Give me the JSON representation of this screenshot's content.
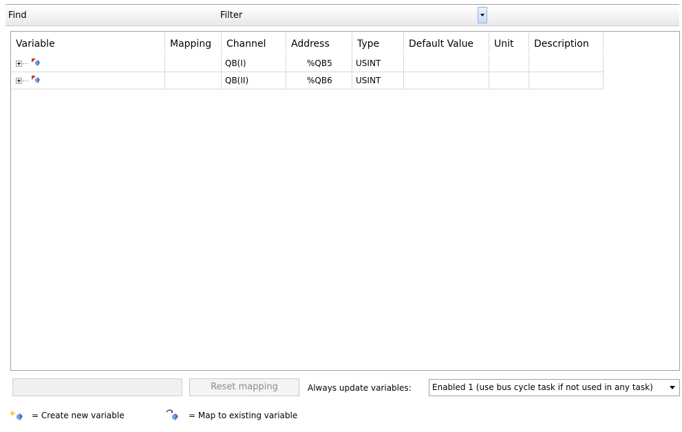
{
  "toolbar": {
    "find_label": "Find",
    "filter_label": "Filter"
  },
  "table": {
    "columns": [
      "Variable",
      "Mapping",
      "Channel",
      "Address",
      "Type",
      "Default Value",
      "Unit",
      "Description"
    ],
    "rows": [
      {
        "variable": "",
        "mapping": "",
        "channel": "QB(I)",
        "address": "%QB5",
        "type": "USINT",
        "default_value": "",
        "unit": "",
        "description": ""
      },
      {
        "variable": "",
        "mapping": "",
        "channel": "QB(II)",
        "address": "%QB6",
        "type": "USINT",
        "default_value": "",
        "unit": "",
        "description": ""
      }
    ]
  },
  "bottom": {
    "reset_label": "Reset mapping",
    "always_label": "Always update variables:",
    "always_value": "Enabled 1 (use bus cycle task if not used in any task)"
  },
  "legend": {
    "create_text": "= Create new variable",
    "map_text": "= Map to existing variable"
  },
  "icons": {
    "expander": "plus-box-icon",
    "variable": "map-variable-icon",
    "create": "create-variable-icon",
    "map": "map-variable-icon"
  }
}
